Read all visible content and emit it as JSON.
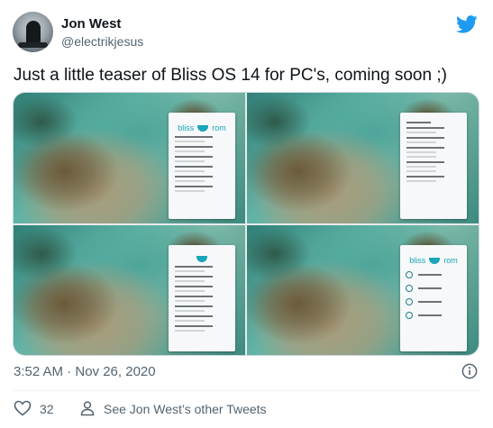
{
  "author": {
    "name": "Jon West",
    "handle": "@electrikjesus",
    "avatar_icon": "avatar-silhouette",
    "platform_icon": "twitter-bird-icon",
    "platform_color": "#1d9bf0"
  },
  "tweet": {
    "text": "Just a little teaser of Bliss OS 14 for PC's, coming soon ;)",
    "timestamp": "3:52 AM · Nov 26, 2020"
  },
  "media": {
    "count": 4,
    "brand": "bliss",
    "brand_suffix": "rom",
    "accent": "#1aa5b8"
  },
  "actions": {
    "like_count": "32",
    "other_tweets_label": "See Jon West’s other Tweets",
    "like_icon": "heart-icon",
    "profile_icon": "person-icon",
    "info_icon": "info-icon"
  }
}
